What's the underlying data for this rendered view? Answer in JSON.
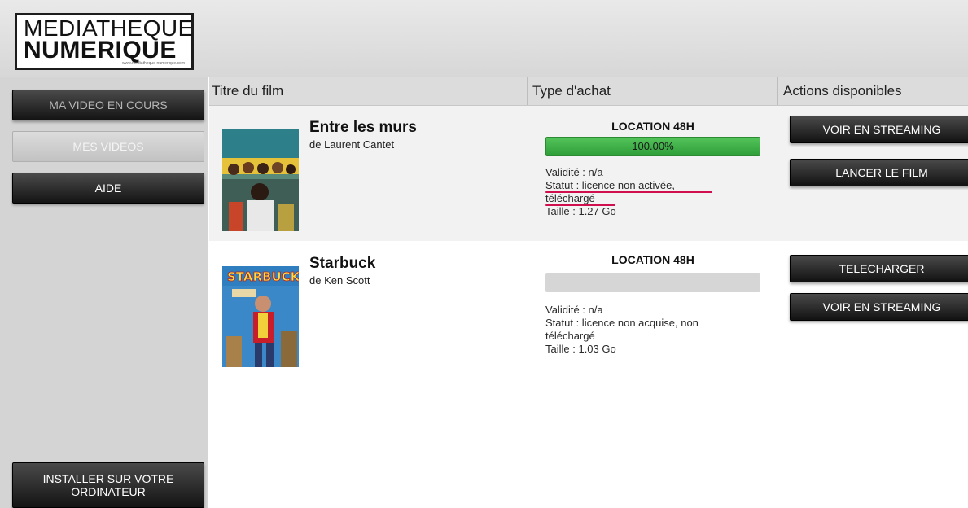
{
  "logo": {
    "line1": "MEDIATHEQUE",
    "line2": "NUMERIQUE",
    "url": "www.mediatheque-numerique.com"
  },
  "sidebar": {
    "buttons": [
      {
        "label": "MA VIDEO EN COURS",
        "state": "normal"
      },
      {
        "label": "MES VIDEOS",
        "state": "disabled"
      },
      {
        "label": "AIDE",
        "state": "normal"
      },
      {
        "label": "INSTALLER SUR VOTRE ORDINATEUR",
        "state": "normal"
      }
    ]
  },
  "table": {
    "headers": [
      "Titre du film",
      "Type d'achat",
      "Actions disponibles"
    ],
    "rows": [
      {
        "title": "Entre les murs",
        "director": "de Laurent Cantet",
        "poster_icon": "poster-entre-les-murs",
        "purchase_type": "LOCATION 48H",
        "progress": 100,
        "progress_label": "100.00%",
        "validity": "Validité : n/a",
        "status_line1": "Statut : licence non activée,",
        "status_line2": "téléchargé",
        "size": "Taille : 1.27 Go",
        "actions": [
          "VOIR EN STREAMING",
          "LANCER LE FILM"
        ]
      },
      {
        "title": "Starbuck",
        "director": "de Ken Scott",
        "poster_icon": "poster-starbuck",
        "purchase_type": "LOCATION 48H",
        "progress": 0,
        "progress_label": "",
        "validity": "Validité : n/a",
        "status_line1": "Statut : licence non acquise, non",
        "status_line2": "téléchargé",
        "size": "Taille : 1.03 Go",
        "actions": [
          "TELECHARGER",
          "VOIR EN STREAMING"
        ]
      }
    ]
  },
  "colors": {
    "progress_green": "#3fb548",
    "annotation_red": "#d0104e",
    "button_dark": "#1a1a1a"
  }
}
